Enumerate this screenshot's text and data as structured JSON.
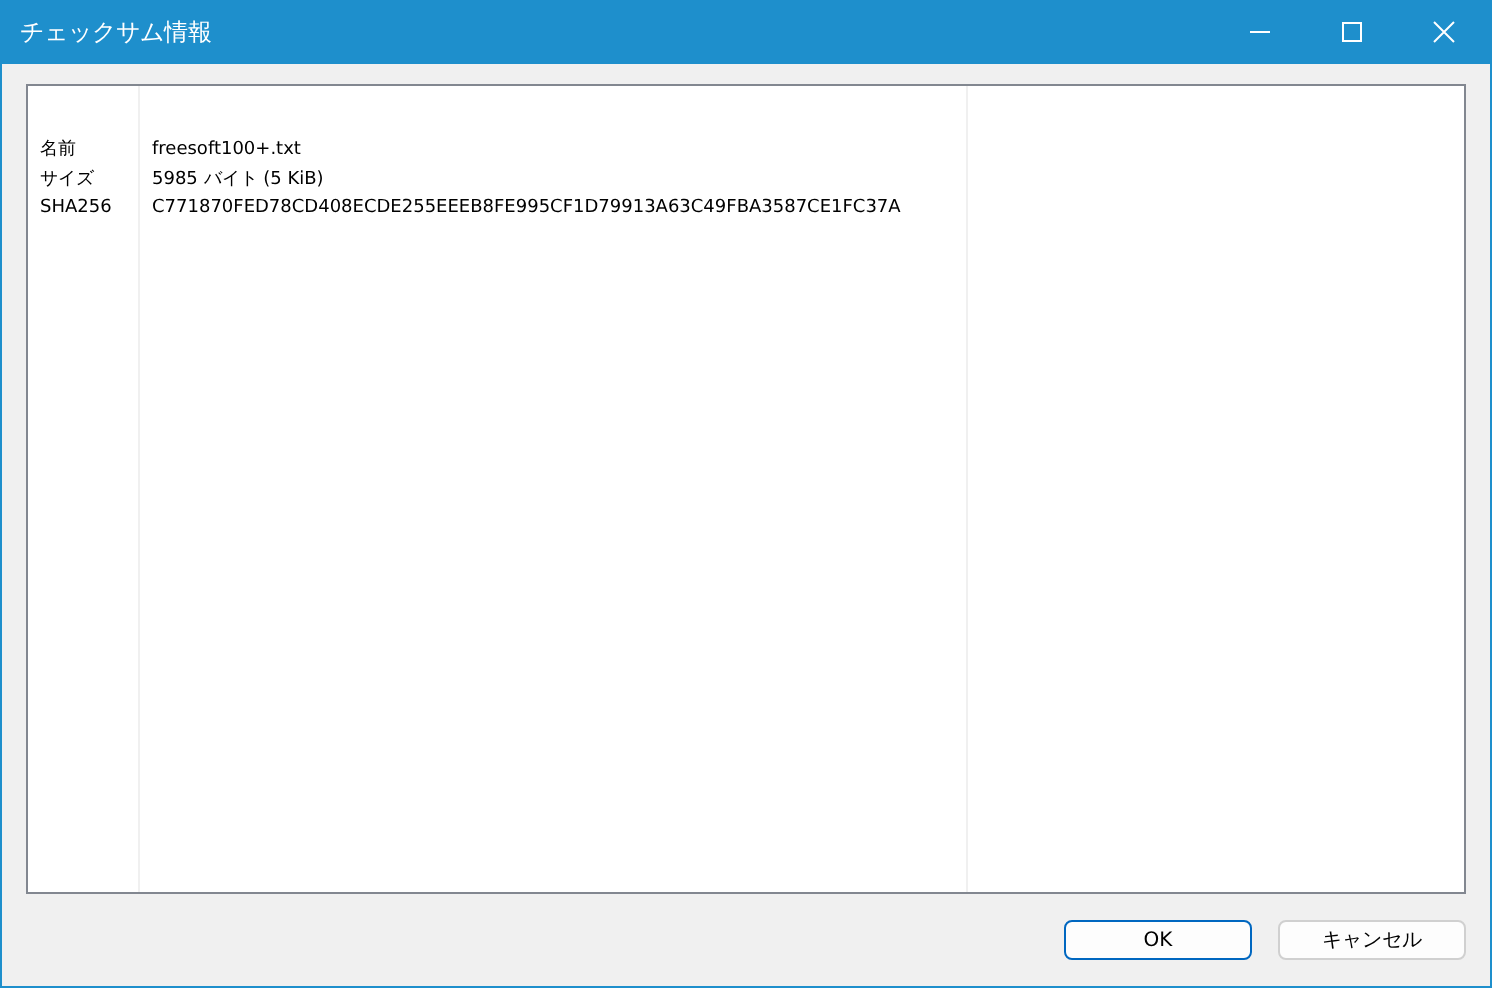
{
  "window": {
    "title": "チェックサム情報"
  },
  "table": {
    "rows": [
      {
        "label": "名前",
        "value": "freesoft100+.txt"
      },
      {
        "label": "サイズ",
        "value": "5985 バイト (5 KiB)"
      },
      {
        "label": "SHA256",
        "value": "C771870FED78CD408ECDE255EEEB8FE995CF1D79913A63C49FBA3587CE1FC37A"
      }
    ]
  },
  "buttons": [
    {
      "label": "OK",
      "kind": "default"
    },
    {
      "label": "キャンセル",
      "kind": "normal"
    }
  ]
}
